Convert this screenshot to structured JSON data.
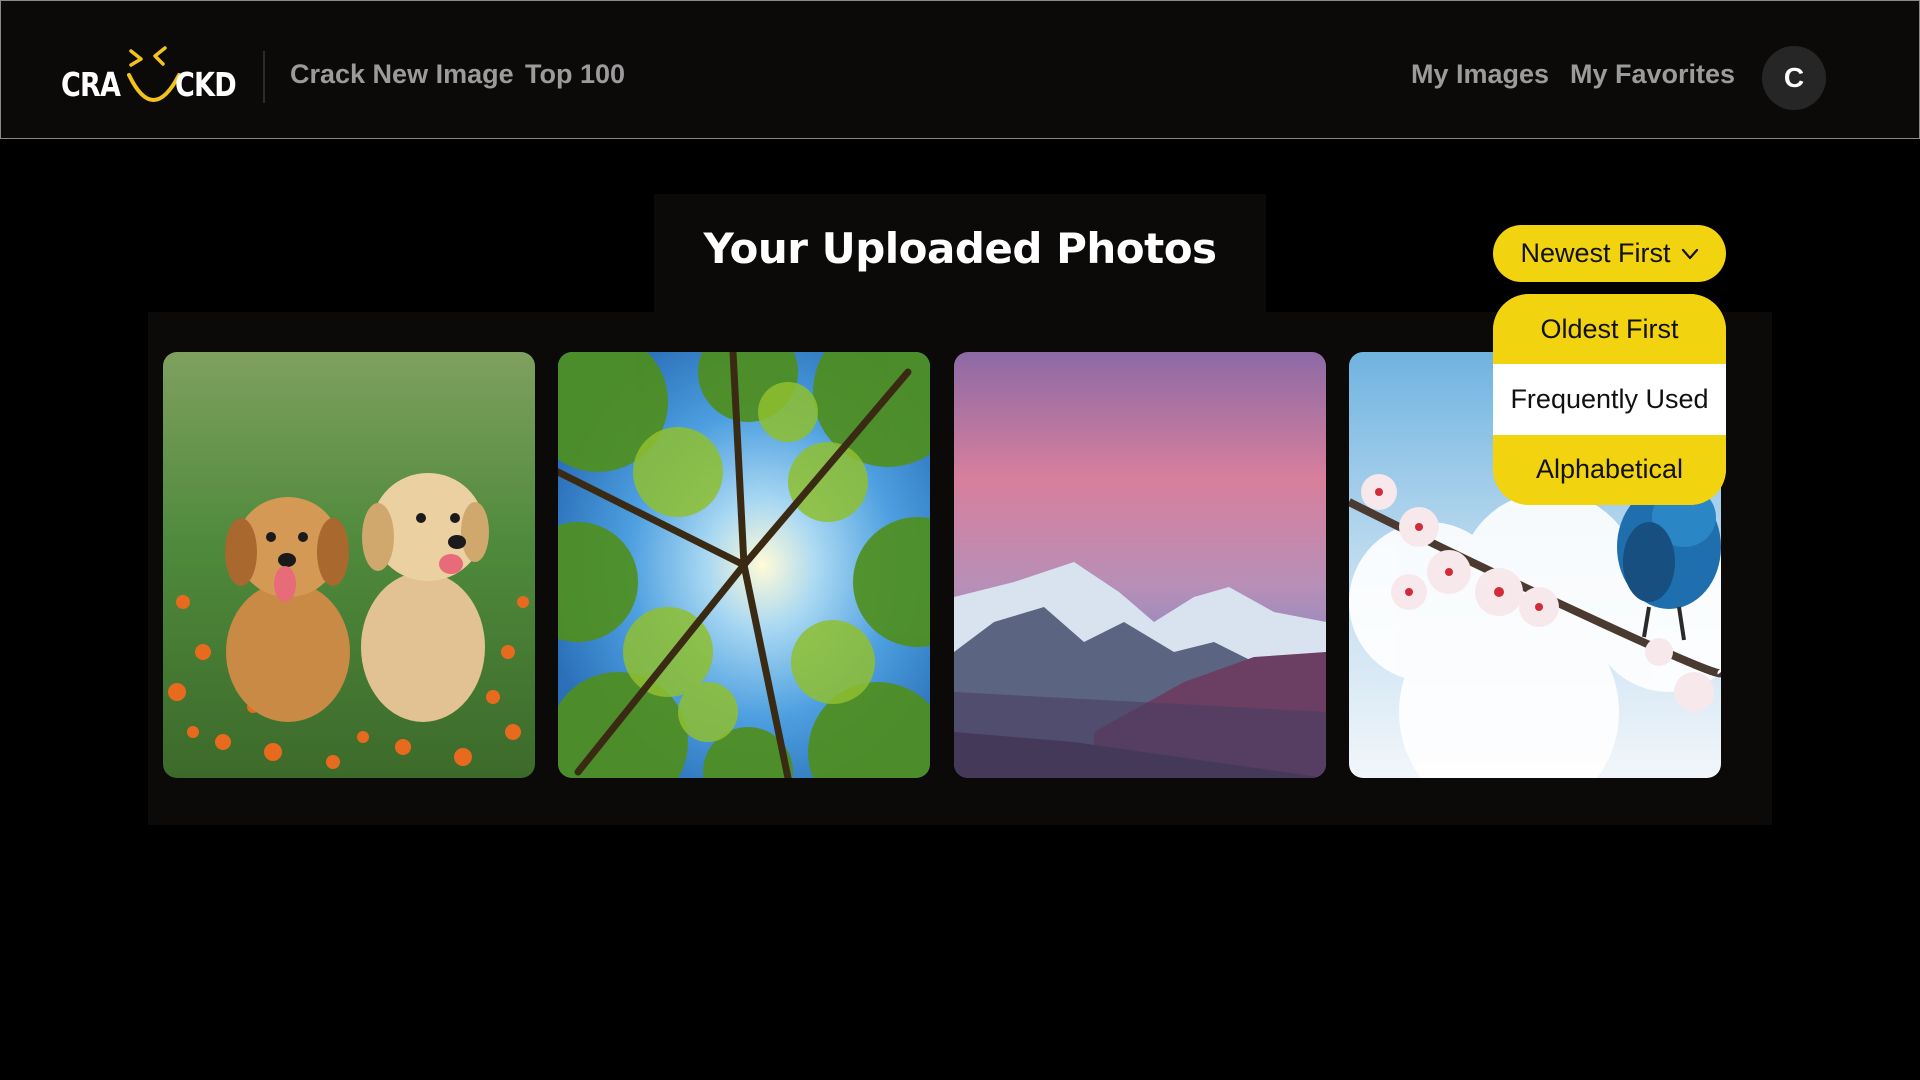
{
  "header": {
    "logo": {
      "left_text": "CRA",
      "right_text": "CKD"
    },
    "nav_left": [
      {
        "label": "Crack New Image"
      },
      {
        "label": "Top 100"
      }
    ],
    "nav_right": [
      {
        "label": "My Images"
      },
      {
        "label": "My Favorites"
      }
    ],
    "avatar_initial": "C"
  },
  "main": {
    "title": "Your Uploaded Photos",
    "sort": {
      "selected": "Newest First",
      "options": [
        {
          "label": "Oldest First"
        },
        {
          "label": "Frequently Used",
          "hovered": true
        },
        {
          "label": "Alphabetical"
        }
      ]
    },
    "photos": [
      {
        "subject": "two golden retriever puppies in grass with orange flowers"
      },
      {
        "subject": "looking up at tree canopy against blue sky"
      },
      {
        "subject": "snowy mountains under pink sunset sky"
      },
      {
        "subject": "blue bird on cherry blossom branch against clouds"
      }
    ]
  },
  "colors": {
    "accent_yellow": "#f2d30f",
    "background": "#000000",
    "panel": "#0b0a09",
    "nav_text": "#9b9b9b"
  },
  "icons": {
    "logo": "smiling-face-logo-icon",
    "dropdown": "chevron-down-icon"
  }
}
